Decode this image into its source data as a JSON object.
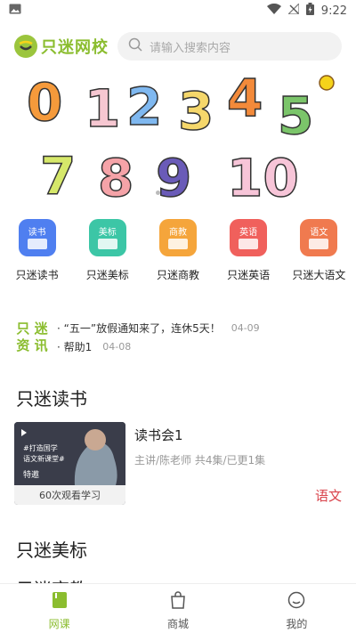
{
  "status_bar": {
    "time": "9:22"
  },
  "header": {
    "brand_name": "只迷网校",
    "search_placeholder": "请输入搜索内容"
  },
  "banner": {
    "digits": [
      "0",
      "1",
      "2",
      "3",
      "4",
      "5",
      "7",
      "8",
      "9",
      "10"
    ]
  },
  "quick_nav": [
    {
      "tag": "读书",
      "label": "只迷读书",
      "color": "#4f7ff0"
    },
    {
      "tag": "美标",
      "label": "只迷美标",
      "color": "#3cc6a6"
    },
    {
      "tag": "商教",
      "label": "只迷商教",
      "color": "#f5a53b"
    },
    {
      "tag": "英语",
      "label": "只迷英语",
      "color": "#f0605c"
    },
    {
      "tag": "语文",
      "label": "只迷大语文",
      "color": "#f07a4f"
    }
  ],
  "news": {
    "logo_line1": "只 迷",
    "logo_line2": "资 讯",
    "items": [
      {
        "text": "· “五一”放假通知来了，连休5天！",
        "date": "04-09"
      },
      {
        "text": "· 帮助1",
        "date": "04-08"
      }
    ]
  },
  "sections": {
    "reading_title": "只迷读书",
    "meibiao_title": "只迷美标",
    "shangjiao_title": "只迷商教"
  },
  "course": {
    "thumb_text1": "#打造国学",
    "thumb_text2": "语文新课堂#",
    "thumb_text3": "特邀",
    "views": "60次观看学习",
    "title": "读书会1",
    "meta": "主讲/陈老师 共4集/已更1集",
    "tag": "语文"
  },
  "bottom_nav": {
    "items": [
      {
        "label": "网课"
      },
      {
        "label": "商城"
      },
      {
        "label": "我的"
      }
    ],
    "active_color": "#8bbd2f"
  }
}
